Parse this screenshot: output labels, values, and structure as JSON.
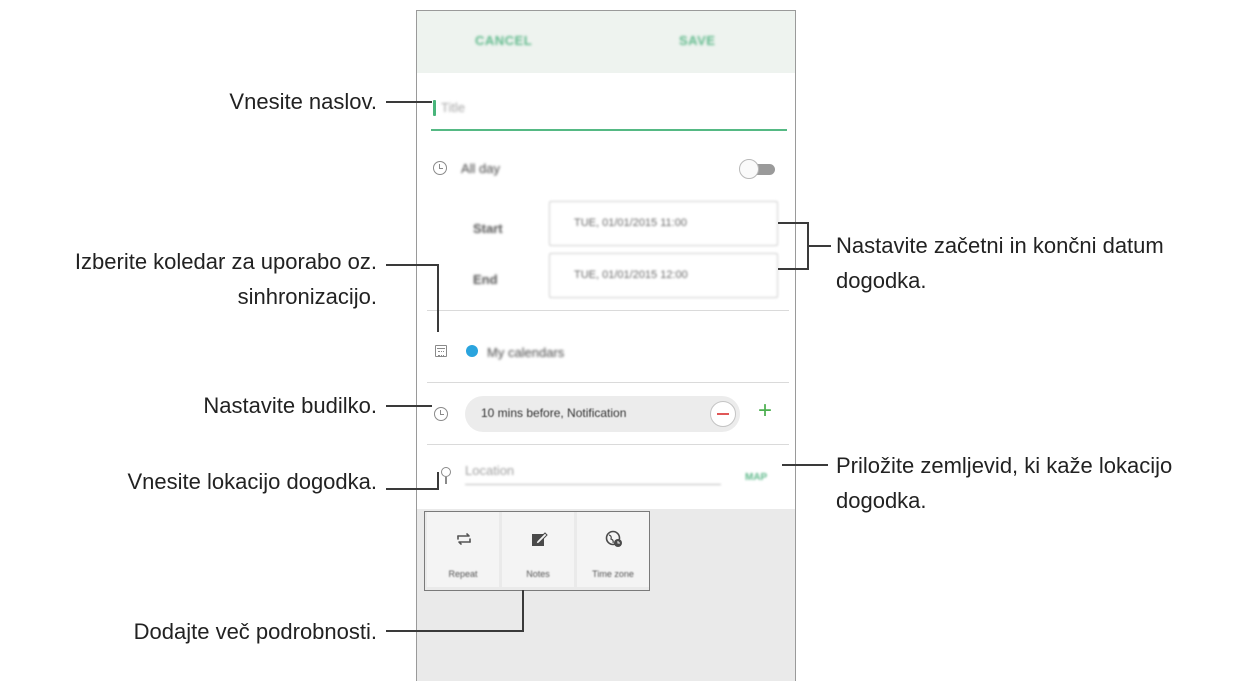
{
  "app": {
    "actions": {
      "cancel": "CANCEL",
      "save": "SAVE"
    },
    "title_placeholder": "Title",
    "all_day": {
      "label": "All day",
      "icon": "clock-icon",
      "enabled": false
    },
    "start": {
      "label": "Start",
      "value": "TUE, 01/01/2015  11:00"
    },
    "end": {
      "label": "End",
      "value": "TUE, 01/01/2015  12:00"
    },
    "calendar": {
      "name": "My calendars",
      "color": "#2aa4de",
      "icon": "calendar-icon"
    },
    "alarm": {
      "text": "10 mins before, Notification",
      "icon": "alarm-clock-icon"
    },
    "location": {
      "placeholder": "Location",
      "map_label": "MAP",
      "icon": "location-pin-icon"
    },
    "more_details": [
      {
        "label": "Repeat",
        "icon": "repeat-icon"
      },
      {
        "label": "Notes",
        "icon": "notes-icon"
      },
      {
        "label": "Time zone",
        "icon": "time-zone-icon"
      }
    ]
  },
  "callouts": {
    "title": "Vnesite naslov.",
    "calendar_line1": "Izberite koledar za uporabo oz.",
    "calendar_line2": "sinhronizacijo.",
    "alarm": "Nastavite budilko.",
    "location": "Vnesite lokacijo dogodka.",
    "details": "Dodajte več podrobnosti.",
    "dates_line1": "Nastavite začetni in končni datum",
    "dates_line2": "dogodka.",
    "map_line1": "Priložite zemljevid, ki kaže lokacijo",
    "map_line2": "dogodka."
  },
  "colors": {
    "accent": "#55b984",
    "calendar_dot": "#2aa4de",
    "alarm_remove": "#e05757",
    "add": "#4caf50"
  }
}
